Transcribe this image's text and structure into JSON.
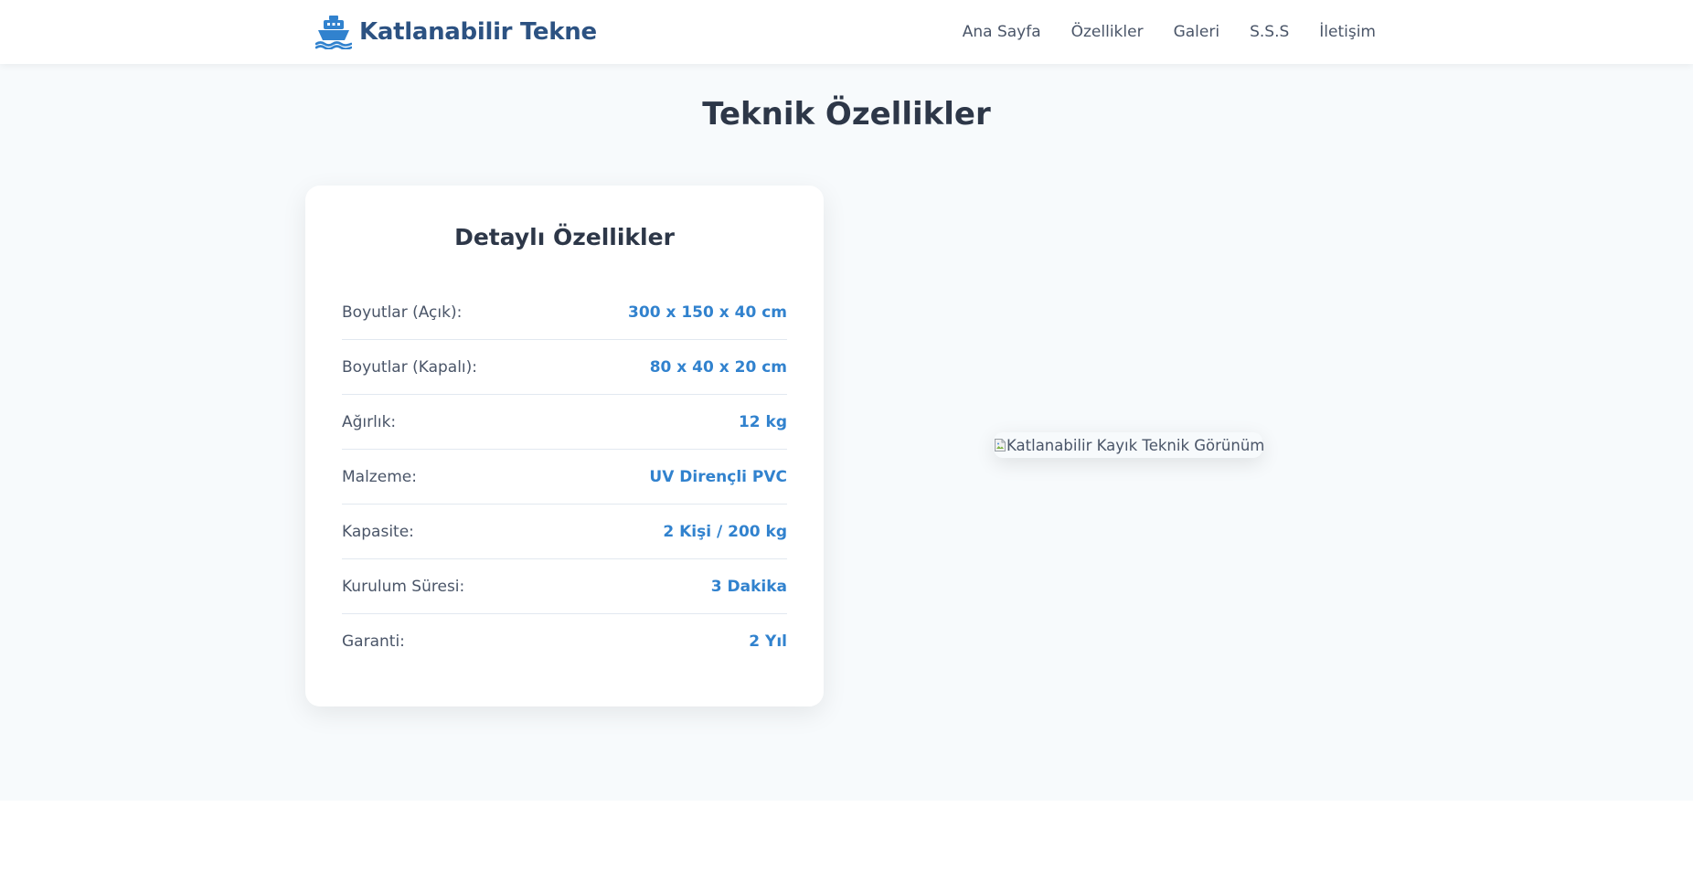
{
  "nav": {
    "brand_icon": "ship-icon",
    "brand": "Katlanabilir Tekne",
    "links": [
      "Ana Sayfa",
      "Özellikler",
      "Galeri",
      "S.S.S",
      "İletişim"
    ]
  },
  "section": {
    "title": "Teknik Özellikler"
  },
  "card": {
    "title": "Detaylı Özellikler",
    "specs": [
      {
        "label": "Boyutlar (Açık):",
        "value": "300 x 150 x 40 cm"
      },
      {
        "label": "Boyutlar (Kapalı):",
        "value": "80 x 40 x 20 cm"
      },
      {
        "label": "Ağırlık:",
        "value": "12 kg"
      },
      {
        "label": "Malzeme:",
        "value": "UV Dirençli PVC"
      },
      {
        "label": "Kapasite:",
        "value": "2 Kişi / 200 kg"
      },
      {
        "label": "Kurulum Süresi:",
        "value": "3 Dakika"
      },
      {
        "label": "Garanti:",
        "value": "2 Yıl"
      }
    ]
  },
  "image": {
    "alt": "Katlanabilir Kayık Teknik Görünüm",
    "icon": "broken-image-icon"
  },
  "colors": {
    "brand": "#2c5282",
    "accent": "#3182ce",
    "section_bg": "#f7fafc"
  }
}
